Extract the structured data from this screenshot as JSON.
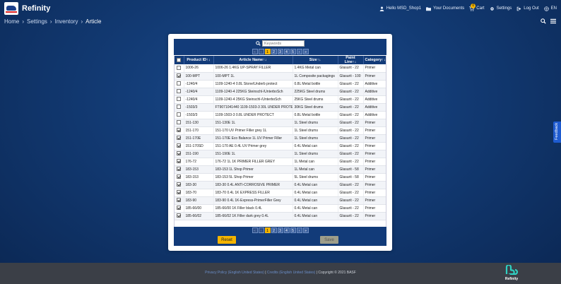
{
  "app": {
    "title": "Refinity"
  },
  "nav": {
    "user": "Hello MSD_Shop1",
    "documents": "Your Documents",
    "cart": "Cart",
    "cart_count": "0",
    "settings": "Settings",
    "logout": "Log Out",
    "language": "EN"
  },
  "breadcrumb": [
    "Home",
    "Settings",
    "Inventory",
    "Article"
  ],
  "search": {
    "placeholder": "Keywords"
  },
  "pager": {
    "pages": [
      "1",
      "2",
      "3",
      "4",
      "5"
    ],
    "active": "1"
  },
  "table": {
    "headers": {
      "product_id": "Product ID↑↓",
      "article_name": "Article Name↑↓",
      "size": "Size↑↓",
      "paint_line": "Paint Line↑↓",
      "category": "Category↑↓"
    },
    "rows": [
      {
        "checked": false,
        "product_id": "1006-26",
        "article_name": "1006-26 1.4KG UP-SPRAY FILLER",
        "size": "1.4KG Metal can",
        "paint_line": "Glasurit - 22",
        "category": "Primer"
      },
      {
        "checked": true,
        "product_id": "100-MPT",
        "article_name": "100-MPT 1L",
        "size": "1L Composite packagings",
        "paint_line": "Glasurit - 100",
        "category": "Primer"
      },
      {
        "checked": false,
        "product_id": "-1240/4",
        "article_name": "1109-1240-4 0.8L Stone/Underb protect",
        "size": "0.8L Metal bottle",
        "paint_line": "Glasurit - 22",
        "category": "Additive"
      },
      {
        "checked": false,
        "product_id": "-1240/4",
        "article_name": "1109-1240-4 225KG Steinschl-/UnterboSch",
        "size": "225KG Steel drums",
        "paint_line": "Glasurit - 22",
        "category": "Additive"
      },
      {
        "checked": false,
        "product_id": "-1240/4",
        "article_name": "1109-1240-4 25KG Steinschl-/UnterboSch",
        "size": "25KG Steel drums",
        "paint_line": "Glasurit - 22",
        "category": "Additive"
      },
      {
        "checked": false,
        "product_id": "-1503/3",
        "article_name": "FT9071041440 1109-1503-3 30L UNDER PROTE",
        "size": "30KG Steel drums",
        "paint_line": "Glasurit - 22",
        "category": "Additive"
      },
      {
        "checked": false,
        "product_id": "-1503/3",
        "article_name": "1109-1503-3 0.8L UNDER PROTECT",
        "size": "0.8L Metal bottle",
        "paint_line": "Glasurit - 22",
        "category": "Additive"
      },
      {
        "checked": false,
        "product_id": "151-130",
        "article_name": "151-130E 1L",
        "size": "1L Steel drums",
        "paint_line": "Glasurit - 22",
        "category": "Primer"
      },
      {
        "checked": true,
        "product_id": "151-170",
        "article_name": "151-170 UV Primer Filler grey 1L",
        "size": "1L Steel drums",
        "paint_line": "Glasurit - 22",
        "category": "Primer"
      },
      {
        "checked": true,
        "product_id": "151-170E",
        "article_name": "151-170E Eco Balance 1L UV Primer Filler",
        "size": "1L Steel drums",
        "paint_line": "Glasurit - 22",
        "category": "Primer"
      },
      {
        "checked": true,
        "product_id": "151-170SD",
        "article_name": "151-170 AE 0.4L UV Primer grey",
        "size": "0.4L Metal can",
        "paint_line": "Glasurit - 22",
        "category": "Primer"
      },
      {
        "checked": true,
        "product_id": "151-190",
        "article_name": "151-190E 1L",
        "size": "1L Steel drums",
        "paint_line": "Glasurit - 22",
        "category": "Primer"
      },
      {
        "checked": true,
        "product_id": "176-72",
        "article_name": "176-72 1L 1K PRIMER FILLER GREY",
        "size": "1L Metal can",
        "paint_line": "Glasurit - 22",
        "category": "Primer"
      },
      {
        "checked": true,
        "product_id": "183-153",
        "article_name": "183-153 1L Shop Primer",
        "size": "1L Metal can",
        "paint_line": "Glasurit - 58",
        "category": "Primer"
      },
      {
        "checked": true,
        "product_id": "183-153",
        "article_name": "183-153 5L Shop Primer",
        "size": "5L Steel drums",
        "paint_line": "Glasurit - 58",
        "category": "Primer"
      },
      {
        "checked": true,
        "product_id": "183-30",
        "article_name": "183-30 0.4L ANTI-CORROSIVE PRIMER",
        "size": "0.4L Metal can",
        "paint_line": "Glasurit - 22",
        "category": "Primer"
      },
      {
        "checked": true,
        "product_id": "183-70",
        "article_name": "183-70 0.4L 1K EXPRESS FILLER",
        "size": "0.4L Metal can",
        "paint_line": "Glasurit - 22",
        "category": "Primer"
      },
      {
        "checked": true,
        "product_id": "183-90",
        "article_name": "183-90 0.4L 1K-Express-PrimerFiller Grey",
        "size": "0.4L Metal can",
        "paint_line": "Glasurit - 22",
        "category": "Primer"
      },
      {
        "checked": true,
        "product_id": "185-66/00",
        "article_name": "185-66/00 1K Filler black 0.4L",
        "size": "0.4L Metal can",
        "paint_line": "Glasurit - 22",
        "category": "Primer"
      },
      {
        "checked": true,
        "product_id": "185-66/02",
        "article_name": "185-66/02 1K Filler dark grey 0.4L",
        "size": "0.4L Metal can",
        "paint_line": "Glasurit - 22",
        "category": "Primer"
      }
    ]
  },
  "buttons": {
    "reset": "Reset",
    "save": "Save"
  },
  "feedback": "Feedback",
  "footer": {
    "privacy": "Privacy Policy (English United States)",
    "divider": "|",
    "credits": "Credits (English United States)",
    "copyright": "Copyright © 2021 BASF",
    "brand": "Refinity"
  },
  "colors": {
    "header_bg": "#123b79",
    "accent": "#f4b400",
    "footer_bg": "#3b3f47",
    "feedback": "#1e5bd0"
  }
}
